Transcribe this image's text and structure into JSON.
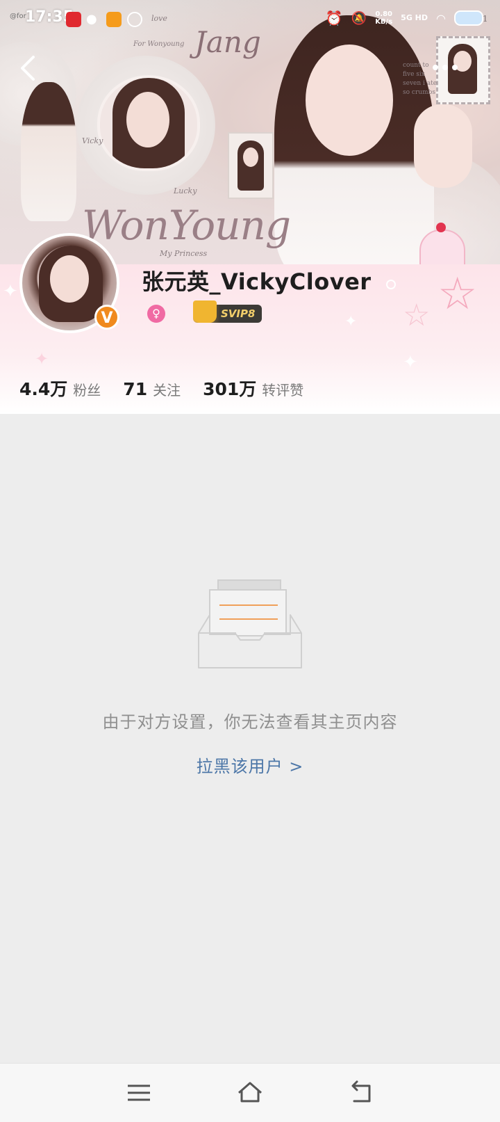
{
  "status_bar": {
    "time": "17:35",
    "net_speed": "0.80",
    "net_speed_unit": "KB/s",
    "network": "5G HD",
    "watermark": "@for",
    "banner_number": "0831"
  },
  "banner": {
    "title": "WonYoung",
    "subtitle": "My Princess",
    "jang": "Jang",
    "vicky": "Vicky",
    "lucky": "Lucky",
    "for_wonyoung": "For Wonyoung",
    "love": "love",
    "side_text": [
      "count to",
      "five six",
      "seven i ate",
      "so crumbs"
    ]
  },
  "profile": {
    "username": "张元英_VickyClover",
    "verified_badge": "V",
    "gender_icon": "female-icon",
    "vip_label": "SVIP8",
    "stats": [
      {
        "value": "4.4万",
        "label": "粉丝"
      },
      {
        "value": "71",
        "label": "关注"
      },
      {
        "value": "301万",
        "label": "转评赞"
      }
    ]
  },
  "empty_state": {
    "message": "由于对方设置，你无法查看其主页内容",
    "action_label": "拉黑该用户 >"
  },
  "colors": {
    "accent_link": "#4d77a8",
    "verified_orange": "#f08a1e",
    "profile_pink": "#fde4ea",
    "page_bg": "#ededed"
  },
  "nav_bar": {
    "buttons": [
      "menu-icon",
      "home-icon",
      "back-icon"
    ]
  }
}
